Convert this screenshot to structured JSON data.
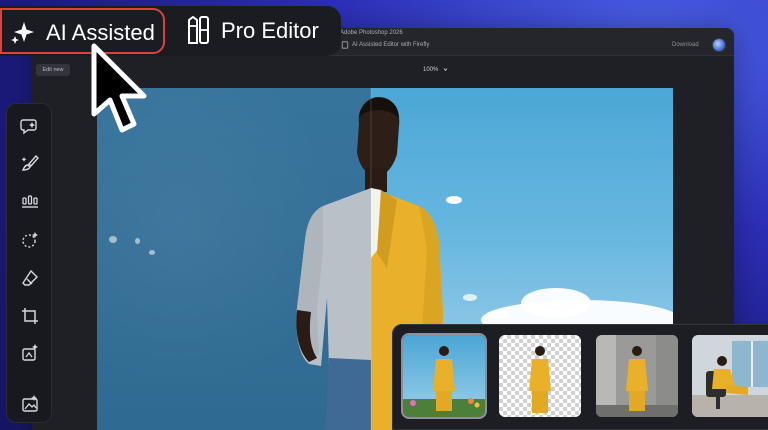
{
  "window": {
    "app_title": "Adobe Photoshop 2026",
    "document_title": "AI Assisted Editor with Firefly",
    "download_label": "Download"
  },
  "toolrow": {
    "edit_new_label": "Edit new",
    "zoom_label": "100%"
  },
  "mode_switch": {
    "ai_label": "AI Assisted",
    "pro_label": "Pro Editor",
    "active": "AI Assisted"
  },
  "left_toolbar": {
    "tools": [
      "generate-chat-icon",
      "brush-icon",
      "adjustments-icon",
      "select-subject-icon",
      "eraser-icon",
      "crop-icon",
      "generative-expand-icon",
      "generate-image-icon"
    ]
  },
  "variations": {
    "thumbnails": [
      "sky-background-variation",
      "transparent-background-variation",
      "concrete-wall-variation",
      "office-chair-variation"
    ]
  },
  "colors": {
    "accent_red": "#e0403d",
    "suit_yellow": "#e9b12a",
    "wall_blue": "#346f97",
    "sky_blue": "#5fb2dd"
  }
}
